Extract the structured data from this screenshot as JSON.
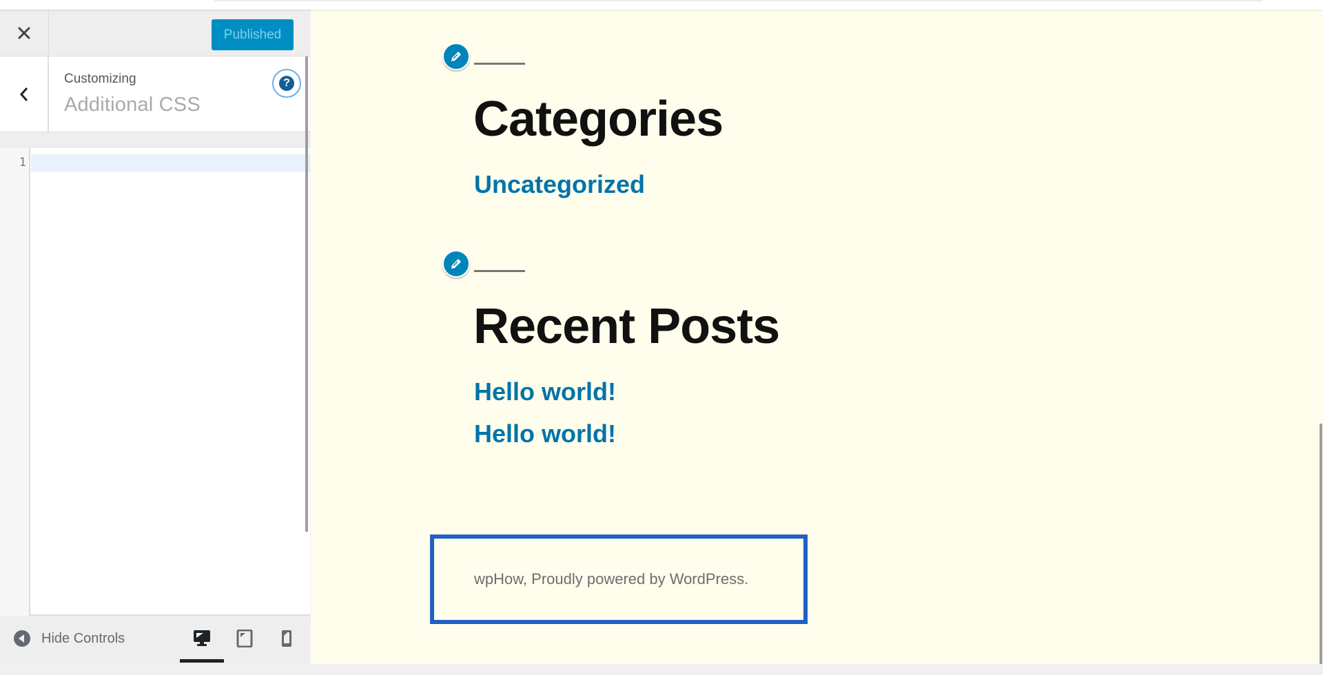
{
  "header": {
    "close_icon": "close-icon",
    "publish_label": "Published"
  },
  "section": {
    "back_icon": "chevron-left-icon",
    "customizing_label": "Customizing",
    "title": "Additional CSS",
    "help_icon": "help-icon",
    "help_glyph": "?"
  },
  "editor": {
    "line_numbers": [
      "1"
    ],
    "content": ""
  },
  "footer": {
    "hide_controls_label": "Hide Controls",
    "devices": [
      {
        "name": "desktop",
        "icon": "desktop-icon",
        "active": true
      },
      {
        "name": "tablet",
        "icon": "tablet-icon",
        "active": false
      },
      {
        "name": "mobile",
        "icon": "mobile-icon",
        "active": false
      }
    ]
  },
  "preview": {
    "widgets": [
      {
        "title": "Categories",
        "links": [
          "Uncategorized"
        ]
      },
      {
        "title": "Recent Posts",
        "links": [
          "Hello world!",
          "Hello world!"
        ]
      }
    ],
    "site_footer_text": "wpHow, Proudly powered by WordPress."
  },
  "colors": {
    "accent": "#0085ba",
    "publish_bg": "#008ec2",
    "link": "#0073aa",
    "preview_bg": "#fffeec",
    "footer_highlight": "#2160c4"
  }
}
